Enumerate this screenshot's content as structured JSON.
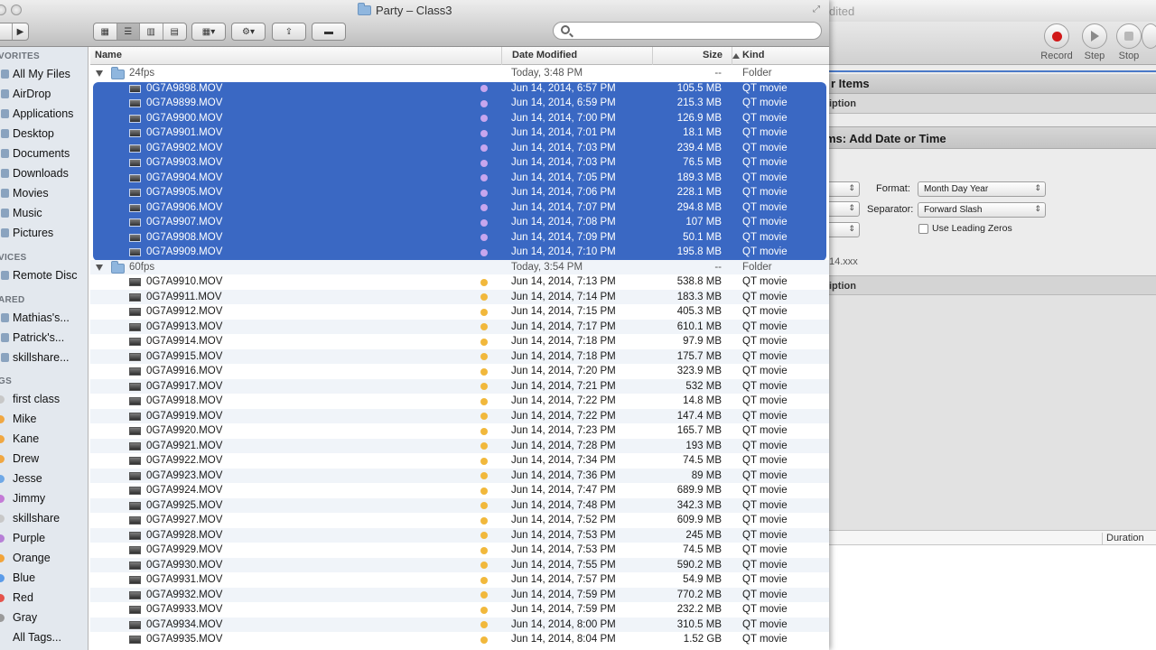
{
  "window": {
    "title": "Party – Class3"
  },
  "automator": {
    "title_fragment": "dited",
    "toolbar": {
      "record": "Record",
      "step": "Step",
      "stop": "Stop"
    },
    "action1_title": "r Items",
    "action1_desc": "iption",
    "action2_title": "ms: Add Date or Time",
    "format_label": "Format:",
    "format_value": "Month Day Year",
    "separator_label": "Separator:",
    "separator_value": "Forward Slash",
    "leading_zeros_label": "Use Leading Zeros",
    "example_fragment": "14.xxx",
    "action2_desc": "iption",
    "log_duration_header": "Duration"
  },
  "search": {
    "placeholder": ""
  },
  "sidebar": {
    "favorites_header": "VORITES",
    "favorites": [
      "All My Files",
      "AirDrop",
      "Applications",
      "Desktop",
      "Documents",
      "Downloads",
      "Movies",
      "Music",
      "Pictures"
    ],
    "devices_header": "VICES",
    "devices": [
      "Remote Disc"
    ],
    "shared_header": "ARED",
    "shared": [
      "Mathias's...",
      "Patrick's...",
      "skillshare..."
    ],
    "tags_header": "GS",
    "tags": [
      {
        "label": "first class",
        "color": "#c8c8c8"
      },
      {
        "label": "Mike",
        "color": "#f0a742"
      },
      {
        "label": "Kane",
        "color": "#f0a742"
      },
      {
        "label": "Drew",
        "color": "#f0a742"
      },
      {
        "label": "Jesse",
        "color": "#6fa8e6"
      },
      {
        "label": "Jimmy",
        "color": "#c47ad6"
      },
      {
        "label": "skillshare",
        "color": "#c8c8c8"
      },
      {
        "label": "Purple",
        "color": "#b77fd6"
      },
      {
        "label": "Orange",
        "color": "#f2a43a"
      },
      {
        "label": "Blue",
        "color": "#5b9be8"
      },
      {
        "label": "Red",
        "color": "#e5534b"
      },
      {
        "label": "Gray",
        "color": "#9a9a9a"
      },
      {
        "label": "All Tags...",
        "color": ""
      }
    ]
  },
  "columns": {
    "name": "Name",
    "date": "Date Modified",
    "size": "Size",
    "kind": "Kind"
  },
  "colors": {
    "selection": "#3a68c3",
    "tag_purple": "#c7a6ee",
    "tag_orange": "#f1b83c"
  },
  "folders": [
    {
      "name": "24fps",
      "date": "Today, 3:48 PM",
      "size": "--",
      "kind": "Folder",
      "selected": true,
      "tag": "purple",
      "files": [
        {
          "name": "0G7A9898.MOV",
          "date": "Jun 14, 2014, 6:57 PM",
          "size": "105.5 MB",
          "kind": "QT movie"
        },
        {
          "name": "0G7A9899.MOV",
          "date": "Jun 14, 2014, 6:59 PM",
          "size": "215.3 MB",
          "kind": "QT movie"
        },
        {
          "name": "0G7A9900.MOV",
          "date": "Jun 14, 2014, 7:00 PM",
          "size": "126.9 MB",
          "kind": "QT movie"
        },
        {
          "name": "0G7A9901.MOV",
          "date": "Jun 14, 2014, 7:01 PM",
          "size": "18.1 MB",
          "kind": "QT movie"
        },
        {
          "name": "0G7A9902.MOV",
          "date": "Jun 14, 2014, 7:03 PM",
          "size": "239.4 MB",
          "kind": "QT movie"
        },
        {
          "name": "0G7A9903.MOV",
          "date": "Jun 14, 2014, 7:03 PM",
          "size": "76.5 MB",
          "kind": "QT movie"
        },
        {
          "name": "0G7A9904.MOV",
          "date": "Jun 14, 2014, 7:05 PM",
          "size": "189.3 MB",
          "kind": "QT movie"
        },
        {
          "name": "0G7A9905.MOV",
          "date": "Jun 14, 2014, 7:06 PM",
          "size": "228.1 MB",
          "kind": "QT movie"
        },
        {
          "name": "0G7A9906.MOV",
          "date": "Jun 14, 2014, 7:07 PM",
          "size": "294.8 MB",
          "kind": "QT movie"
        },
        {
          "name": "0G7A9907.MOV",
          "date": "Jun 14, 2014, 7:08 PM",
          "size": "107 MB",
          "kind": "QT movie"
        },
        {
          "name": "0G7A9908.MOV",
          "date": "Jun 14, 2014, 7:09 PM",
          "size": "50.1 MB",
          "kind": "QT movie"
        },
        {
          "name": "0G7A9909.MOV",
          "date": "Jun 14, 2014, 7:10 PM",
          "size": "195.8 MB",
          "kind": "QT movie"
        }
      ]
    },
    {
      "name": "60fps",
      "date": "Today, 3:54 PM",
      "size": "--",
      "kind": "Folder",
      "selected": false,
      "tag": "orange",
      "files": [
        {
          "name": "0G7A9910.MOV",
          "date": "Jun 14, 2014, 7:13 PM",
          "size": "538.8 MB",
          "kind": "QT movie"
        },
        {
          "name": "0G7A9911.MOV",
          "date": "Jun 14, 2014, 7:14 PM",
          "size": "183.3 MB",
          "kind": "QT movie"
        },
        {
          "name": "0G7A9912.MOV",
          "date": "Jun 14, 2014, 7:15 PM",
          "size": "405.3 MB",
          "kind": "QT movie"
        },
        {
          "name": "0G7A9913.MOV",
          "date": "Jun 14, 2014, 7:17 PM",
          "size": "610.1 MB",
          "kind": "QT movie"
        },
        {
          "name": "0G7A9914.MOV",
          "date": "Jun 14, 2014, 7:18 PM",
          "size": "97.9 MB",
          "kind": "QT movie"
        },
        {
          "name": "0G7A9915.MOV",
          "date": "Jun 14, 2014, 7:18 PM",
          "size": "175.7 MB",
          "kind": "QT movie"
        },
        {
          "name": "0G7A9916.MOV",
          "date": "Jun 14, 2014, 7:20 PM",
          "size": "323.9 MB",
          "kind": "QT movie"
        },
        {
          "name": "0G7A9917.MOV",
          "date": "Jun 14, 2014, 7:21 PM",
          "size": "532 MB",
          "kind": "QT movie"
        },
        {
          "name": "0G7A9918.MOV",
          "date": "Jun 14, 2014, 7:22 PM",
          "size": "14.8 MB",
          "kind": "QT movie"
        },
        {
          "name": "0G7A9919.MOV",
          "date": "Jun 14, 2014, 7:22 PM",
          "size": "147.4 MB",
          "kind": "QT movie"
        },
        {
          "name": "0G7A9920.MOV",
          "date": "Jun 14, 2014, 7:23 PM",
          "size": "165.7 MB",
          "kind": "QT movie"
        },
        {
          "name": "0G7A9921.MOV",
          "date": "Jun 14, 2014, 7:28 PM",
          "size": "193 MB",
          "kind": "QT movie"
        },
        {
          "name": "0G7A9922.MOV",
          "date": "Jun 14, 2014, 7:34 PM",
          "size": "74.5 MB",
          "kind": "QT movie"
        },
        {
          "name": "0G7A9923.MOV",
          "date": "Jun 14, 2014, 7:36 PM",
          "size": "89 MB",
          "kind": "QT movie"
        },
        {
          "name": "0G7A9924.MOV",
          "date": "Jun 14, 2014, 7:47 PM",
          "size": "689.9 MB",
          "kind": "QT movie"
        },
        {
          "name": "0G7A9925.MOV",
          "date": "Jun 14, 2014, 7:48 PM",
          "size": "342.3 MB",
          "kind": "QT movie"
        },
        {
          "name": "0G7A9927.MOV",
          "date": "Jun 14, 2014, 7:52 PM",
          "size": "609.9 MB",
          "kind": "QT movie"
        },
        {
          "name": "0G7A9928.MOV",
          "date": "Jun 14, 2014, 7:53 PM",
          "size": "245 MB",
          "kind": "QT movie"
        },
        {
          "name": "0G7A9929.MOV",
          "date": "Jun 14, 2014, 7:53 PM",
          "size": "74.5 MB",
          "kind": "QT movie"
        },
        {
          "name": "0G7A9930.MOV",
          "date": "Jun 14, 2014, 7:55 PM",
          "size": "590.2 MB",
          "kind": "QT movie"
        },
        {
          "name": "0G7A9931.MOV",
          "date": "Jun 14, 2014, 7:57 PM",
          "size": "54.9 MB",
          "kind": "QT movie"
        },
        {
          "name": "0G7A9932.MOV",
          "date": "Jun 14, 2014, 7:59 PM",
          "size": "770.2 MB",
          "kind": "QT movie"
        },
        {
          "name": "0G7A9933.MOV",
          "date": "Jun 14, 2014, 7:59 PM",
          "size": "232.2 MB",
          "kind": "QT movie"
        },
        {
          "name": "0G7A9934.MOV",
          "date": "Jun 14, 2014, 8:00 PM",
          "size": "310.5 MB",
          "kind": "QT movie"
        },
        {
          "name": "0G7A9935.MOV",
          "date": "Jun 14, 2014, 8:04 PM",
          "size": "1.52 GB",
          "kind": "QT movie"
        }
      ]
    }
  ]
}
